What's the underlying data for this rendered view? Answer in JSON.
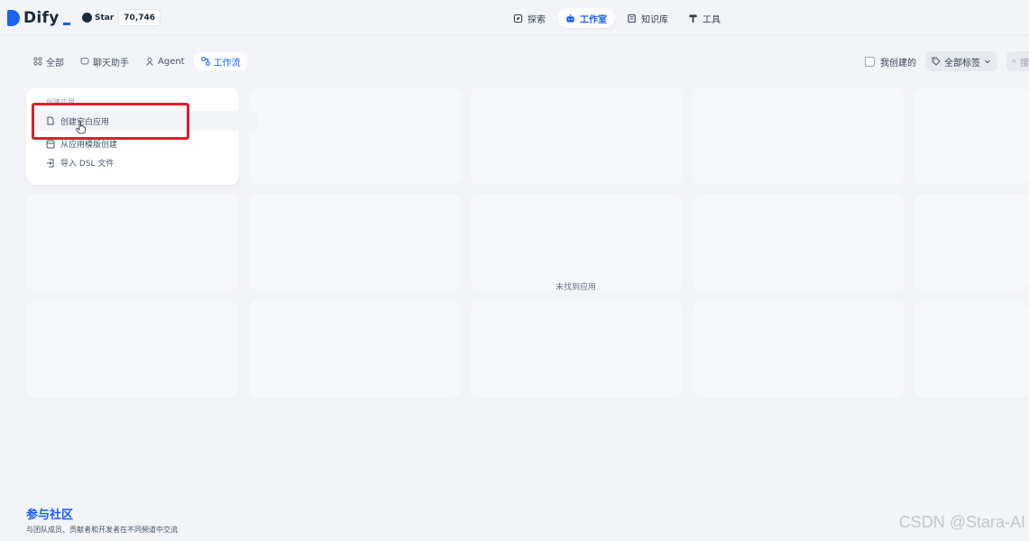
{
  "app": {
    "name": "Dify"
  },
  "github": {
    "star_label": "Star",
    "star_count": "70,746"
  },
  "nav": {
    "items": [
      {
        "label": "探索",
        "icon": "compass-icon",
        "active": false
      },
      {
        "label": "工作室",
        "icon": "robot-icon",
        "active": true
      },
      {
        "label": "知识库",
        "icon": "book-icon",
        "active": false
      },
      {
        "label": "工具",
        "icon": "hammer-icon",
        "active": false
      }
    ]
  },
  "filters": {
    "tabs": [
      {
        "label": "全部",
        "icon": "grid-icon",
        "active": false
      },
      {
        "label": "聊天助手",
        "icon": "chat-icon",
        "active": false
      },
      {
        "label": "Agent",
        "icon": "agent-icon",
        "active": false
      },
      {
        "label": "工作流",
        "icon": "workflow-icon",
        "active": true
      }
    ],
    "mine_label": "我创建的",
    "tags_label": "全部标签",
    "search_placeholder": "搜"
  },
  "create_card": {
    "title": "创建应用",
    "items": [
      {
        "label": "创建空白应用",
        "icon": "file-icon"
      },
      {
        "label": "从应用模版创建",
        "icon": "template-icon"
      },
      {
        "label": "导入 DSL 文件",
        "icon": "import-icon"
      }
    ]
  },
  "empty_state": "未找到应用",
  "community": {
    "title": "参与社区",
    "description": "与团队成员、贡献者和开发者在不同频道中交流"
  },
  "watermark": "CSDN @Stara-AI",
  "colors": {
    "accent": "#155eef",
    "highlight": "#e11d2b",
    "background": "#f2f4f7"
  }
}
